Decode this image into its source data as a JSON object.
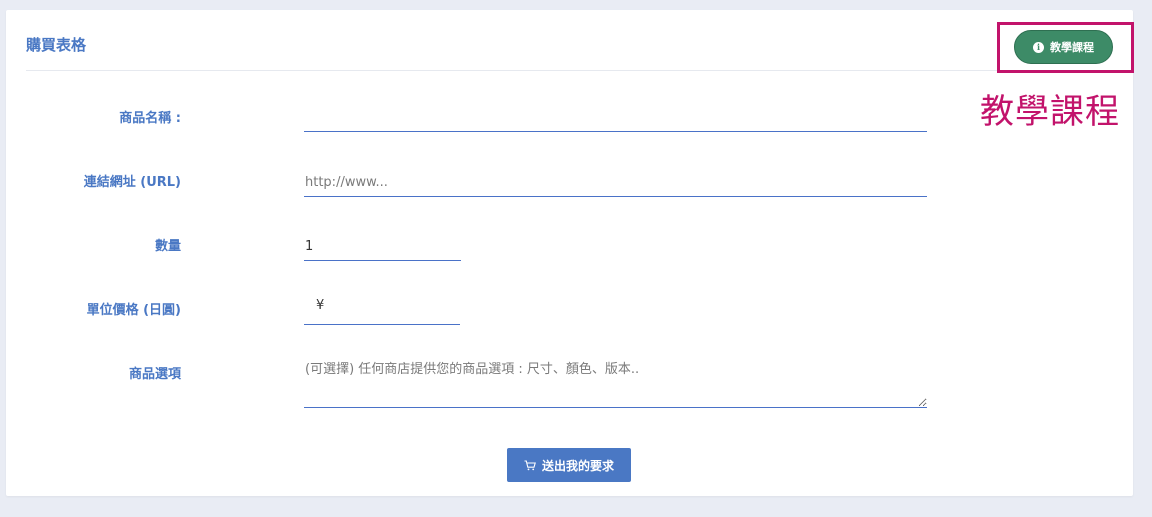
{
  "form": {
    "title": "購買表格",
    "tutorial_button_label": "教學課程",
    "tutorial_annotation": "教學課程",
    "fields": [
      {
        "label": "商品名稱 :",
        "value": "",
        "placeholder": ""
      },
      {
        "label": "連結網址 (URL)",
        "value": "",
        "placeholder": "http://www..."
      },
      {
        "label": "數量",
        "value": "1",
        "placeholder": ""
      },
      {
        "label": "單位價格 (日圓)",
        "value": "",
        "placeholder": "",
        "prefix": "¥"
      },
      {
        "label": "商品選項",
        "value": "",
        "placeholder": "(可選擇) 任何商店提供您的商品選項 : 尺寸、顏色、版本.."
      }
    ],
    "submit_label": "送出我的要求"
  },
  "icons": {
    "tutorial": "info-circle-icon",
    "submit": "shopping-cart-icon"
  },
  "colors": {
    "accent": "#4a78c4",
    "tutorial_button": "#3d8b67",
    "annotation": "#c2136b",
    "background": "#e9ecf4"
  }
}
